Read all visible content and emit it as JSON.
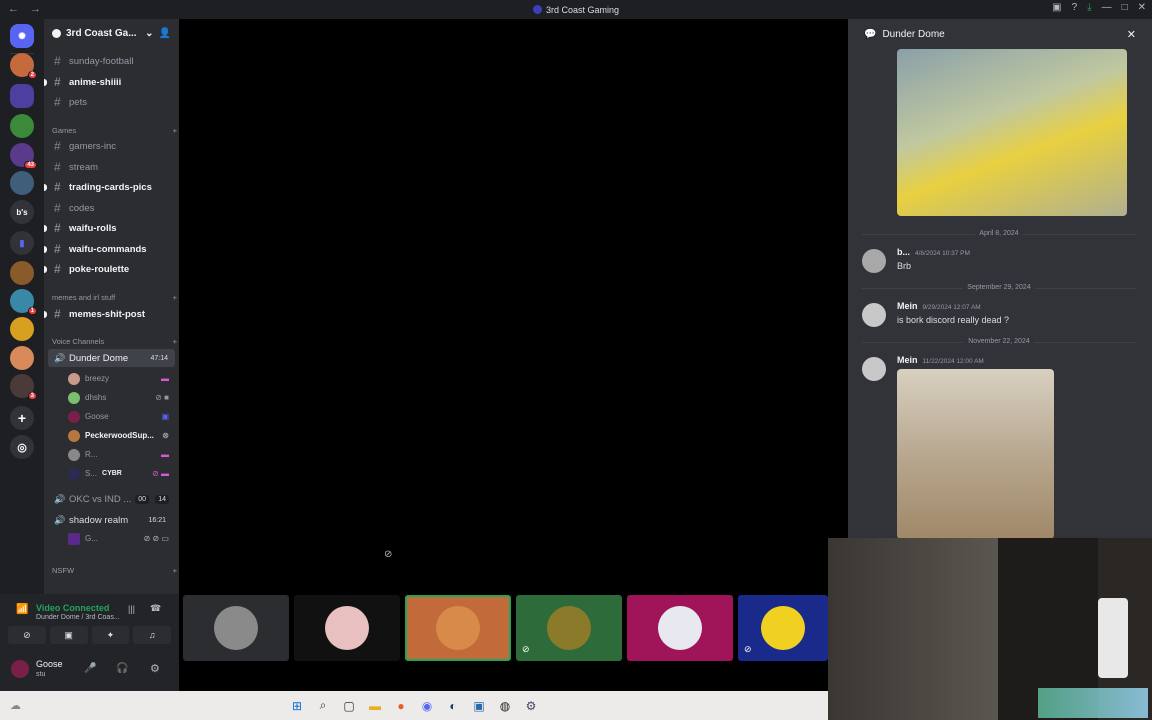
{
  "window": {
    "title": "3rd Coast Gaming"
  },
  "server": {
    "name": "3rd Coast Ga..."
  },
  "channels": [
    {
      "name": "sunday-football",
      "unread": false
    },
    {
      "name": "anime-shiiii",
      "unread": true
    },
    {
      "name": "pets",
      "unread": false
    }
  ],
  "categories": {
    "games": "Games",
    "memes": "memes and irl stuff",
    "voice": "Voice Channels",
    "nsfw": "NSFW"
  },
  "games_channels": [
    {
      "name": "gamers-inc",
      "unread": false
    },
    {
      "name": "stream",
      "unread": false
    },
    {
      "name": "trading-cards-pics",
      "unread": true
    },
    {
      "name": "codes",
      "unread": false
    },
    {
      "name": "waifu-rolls",
      "unread": true
    },
    {
      "name": "waifu-commands",
      "unread": true
    },
    {
      "name": "poke-roulette",
      "unread": true
    }
  ],
  "memes_channels": [
    {
      "name": "memes-shit-post",
      "unread": true
    }
  ],
  "voice": {
    "active": {
      "name": "Dunder Dome",
      "time": "47:14"
    },
    "users": [
      {
        "name": "breezy",
        "color": "#c79a8a"
      },
      {
        "name": "dhshs",
        "color": "#7cbf6e"
      },
      {
        "name": "Goose",
        "color": "#7a1f4a"
      },
      {
        "name": "PeckerwoodSup...",
        "color": "#b8753f"
      },
      {
        "name": "R...",
        "color": "#888888"
      },
      {
        "name": "S...",
        "color": "#2b2b55",
        "extra": "CYBR"
      }
    ],
    "others": [
      {
        "name": "OKC vs IND ...",
        "tag1": "00",
        "tag2": "14"
      },
      {
        "name": "shadow realm",
        "tag": "16:21"
      }
    ],
    "shadow_user": "G..."
  },
  "guild_badges": [
    "2",
    "43",
    "1",
    "3"
  ],
  "guild_text": "b's",
  "status": {
    "connected": "Video Connected",
    "location": "Dunder Dome / 3rd Coas..."
  },
  "user": {
    "name": "Goose",
    "status": "stu"
  },
  "chat": {
    "title": "Dunder Dome",
    "dividers": [
      "April 8, 2024",
      "September 29, 2024",
      "November 22, 2024"
    ],
    "messages": [
      {
        "author": "b...",
        "timestamp": "4/8/2024 10:37 PM",
        "text": "Brb"
      },
      {
        "author": "Mein",
        "timestamp": "9/29/2024 12:07 AM",
        "text": "is bork discord really dead ?"
      },
      {
        "author": "Mein",
        "timestamp": "11/22/2024 12:00 AM",
        "text": ""
      }
    ]
  },
  "colors": {
    "accent": "#23a559",
    "badge": "#f23f43"
  }
}
